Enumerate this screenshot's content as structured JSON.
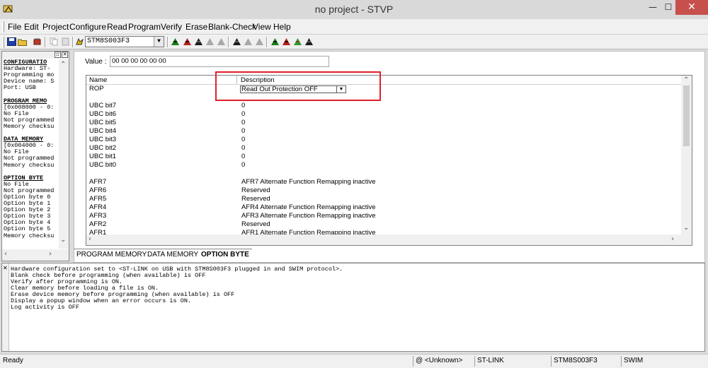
{
  "window": {
    "title": "no project - STVP",
    "min_glyph": "—",
    "max_glyph": "☐",
    "close_glyph": "✕"
  },
  "menu": [
    "File",
    "Edit",
    "Project",
    "Configure",
    "Read",
    "Program",
    "Verify",
    "Erase",
    "Blank-Check",
    "View",
    "Help"
  ],
  "toolbar": {
    "device": "STM8S003F3",
    "icons": [
      "save-icon",
      "open-icon",
      "device-icon",
      "copy-icon",
      "paste-icon",
      "hand-icon",
      "read-icon",
      "read-all-icon",
      "read-current-icon",
      "program-icon",
      "program-all-icon",
      "verify-icon",
      "verify-all-icon",
      "erase-icon",
      "blank-check-icon"
    ]
  },
  "left_panel": {
    "lines": [
      {
        "text": "CONFIGURATIO",
        "head": true
      },
      {
        "text": "Hardware: ST-",
        "head": false
      },
      {
        "text": "Programming mo",
        "head": false
      },
      {
        "text": "Device name: S",
        "head": false
      },
      {
        "text": "Port: USB",
        "head": false
      },
      {
        "text": "",
        "head": false
      },
      {
        "text": "PROGRAM MEMO",
        "head": true
      },
      {
        "text": "[0x008000 - 0:",
        "head": false
      },
      {
        "text": "No File",
        "head": false
      },
      {
        "text": "Not programmed",
        "head": false
      },
      {
        "text": "Memory checksu",
        "head": false
      },
      {
        "text": "",
        "head": false
      },
      {
        "text": "DATA MEMORY",
        "head": true
      },
      {
        "text": "[0x004000 - 0:",
        "head": false
      },
      {
        "text": "No File",
        "head": false
      },
      {
        "text": "Not programmed",
        "head": false
      },
      {
        "text": "Memory checksu",
        "head": false
      },
      {
        "text": "",
        "head": false
      },
      {
        "text": "OPTION BYTE",
        "head": true
      },
      {
        "text": "No File",
        "head": false
      },
      {
        "text": "Not programmed",
        "head": false
      },
      {
        "text": "Option byte 0",
        "head": false
      },
      {
        "text": "Option byte 1",
        "head": false
      },
      {
        "text": "Option byte 2",
        "head": false
      },
      {
        "text": "Option byte 3",
        "head": false
      },
      {
        "text": "Option byte 4",
        "head": false
      },
      {
        "text": "Option byte 5",
        "head": false
      },
      {
        "text": "Memory checksu",
        "head": false
      }
    ]
  },
  "main": {
    "value_label": "Value :",
    "value": "00 00 00 00 00 00",
    "columns": [
      "Name",
      "Description"
    ],
    "rop": {
      "name": "ROP",
      "value": "Read Out Protection OFF"
    },
    "rows": [
      {
        "name": "",
        "desc": ""
      },
      {
        "name": "UBC bit7",
        "desc": "0"
      },
      {
        "name": "UBC bit6",
        "desc": "0"
      },
      {
        "name": "UBC bit5",
        "desc": "0"
      },
      {
        "name": "UBC bit4",
        "desc": "0"
      },
      {
        "name": "UBC bit3",
        "desc": "0"
      },
      {
        "name": "UBC bit2",
        "desc": "0"
      },
      {
        "name": "UBC bit1",
        "desc": "0"
      },
      {
        "name": "UBC bit0",
        "desc": "0"
      },
      {
        "name": "",
        "desc": ""
      },
      {
        "name": "AFR7",
        "desc": "AFR7 Alternate Function Remapping inactive"
      },
      {
        "name": "AFR6",
        "desc": "Reserved"
      },
      {
        "name": "AFR5",
        "desc": "Reserved"
      },
      {
        "name": "AFR4",
        "desc": "AFR4 Alternate Function Remapping inactive"
      },
      {
        "name": "AFR3",
        "desc": "AFR3 Alternate Function Remapping inactive"
      },
      {
        "name": "AFR2",
        "desc": "Reserved"
      },
      {
        "name": "AFR1",
        "desc": "AFR1 Alternate Function Remapping inactive"
      }
    ]
  },
  "tabs": [
    {
      "label": "PROGRAM MEMORY",
      "active": false
    },
    {
      "label": "DATA MEMORY",
      "active": false
    },
    {
      "label": "OPTION BYTE",
      "active": true
    }
  ],
  "log": [
    "Hardware configuration set to <ST-LINK on USB with STM8S003F3 plugged in and SWIM protocol>.",
    "Blank check before programming (when available) is OFF",
    "Verify after programming is ON.",
    "Clear memory before loading a file is ON.",
    "Erase device memory before programming (when available) is OFF",
    "Display a popup window when an error occurs is ON.",
    "Log activity is OFF"
  ],
  "status": {
    "ready": "Ready",
    "location": "@ <Unknown>",
    "probe": "ST-LINK",
    "device": "STM8S003F3",
    "protocol": "SWIM"
  },
  "colors": {
    "highlight": "#e0202a",
    "close_button": "#c7504c"
  }
}
